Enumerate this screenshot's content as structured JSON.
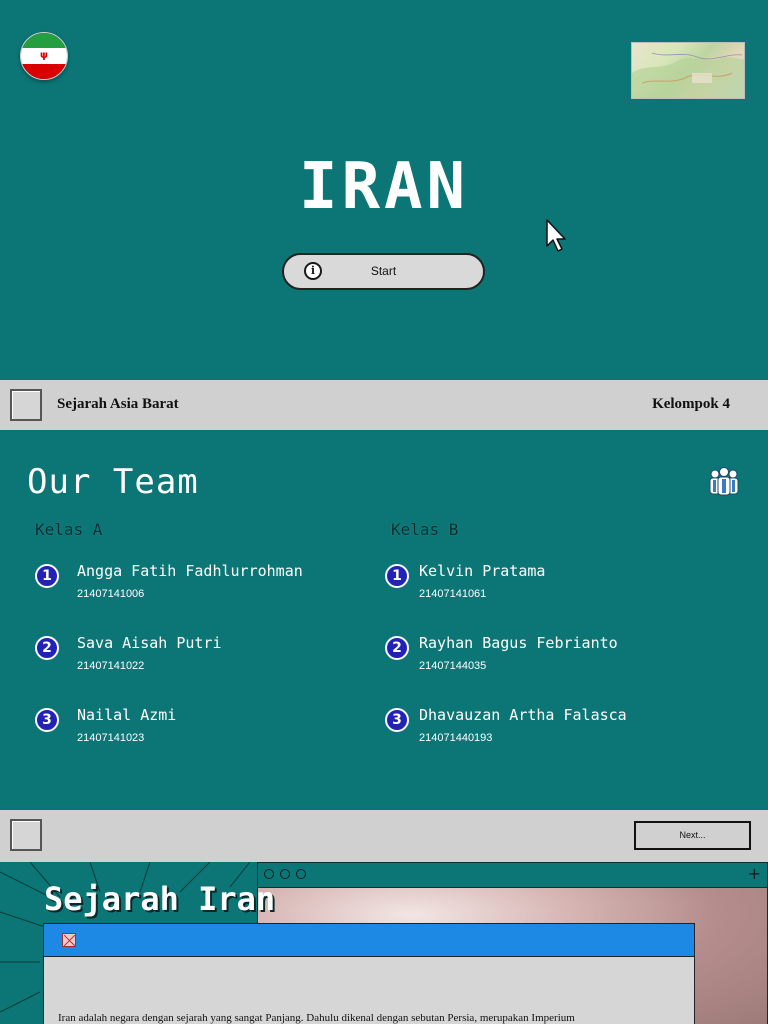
{
  "slide1": {
    "title": "IRAN",
    "start_label": "Start",
    "flag_icon": "iran-flag-icon",
    "map_icon": "persian-empire-map-thumbnail",
    "cursor_icon": "mouse-pointer-icon"
  },
  "bar1": {
    "left_text": "Sejarah Asia Barat",
    "right_text": "Kelompok 4"
  },
  "team": {
    "title": "Our Team",
    "icon": "team-people-icon",
    "class_a": {
      "heading": "Kelas A",
      "members": [
        {
          "num": "1",
          "name": "Angga Fatih Fadhlurrohman",
          "nim": "21407141006"
        },
        {
          "num": "2",
          "name": "Sava Aisah Putri",
          "nim": "21407141022"
        },
        {
          "num": "3",
          "name": "Nailal Azmi",
          "nim": "21407141023"
        }
      ]
    },
    "class_b": {
      "heading": "Kelas B",
      "members": [
        {
          "num": "1",
          "name": "Kelvin Pratama",
          "nim": "21407141061"
        },
        {
          "num": "2",
          "name": "Rayhan Bagus Febrianto",
          "nim": "21407144035"
        },
        {
          "num": "3",
          "name": "Dhavauzan Artha Falasca",
          "nim": "214071440193"
        }
      ]
    }
  },
  "bar2": {
    "next_label": "Next..."
  },
  "slide3": {
    "title": "Sejarah Iran",
    "text": "Iran adalah negara dengan sejarah yang sangat Panjang. Dahulu dikenal dengan sebutan Persia, merupakan Imperium"
  },
  "colors": {
    "teal": "#0c7676",
    "bar_gray": "#d0d0d0",
    "window_blue": "#1e88e5",
    "badge_blue": "#2222b8"
  }
}
